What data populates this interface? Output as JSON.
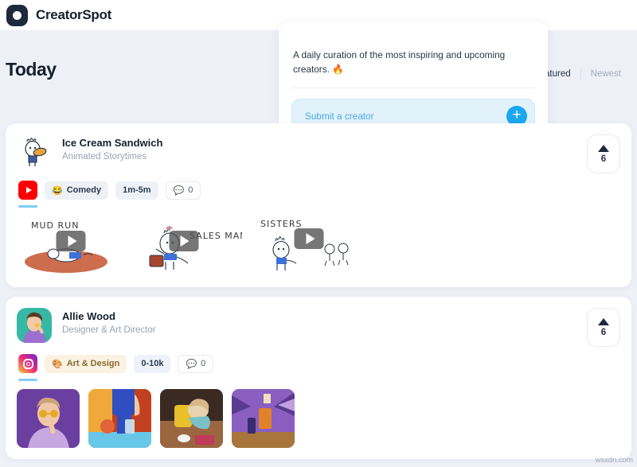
{
  "brand": {
    "name": "CreatorSpot",
    "logo_icon": "circle-logo-icon"
  },
  "hero": {
    "section_title": "Today",
    "tabs": [
      {
        "label": "Featured",
        "active": true
      },
      {
        "label": "Newest",
        "active": false
      }
    ]
  },
  "promo": {
    "description": "A daily curation of the most inspiring and upcoming creators. 🔥",
    "submit_placeholder": "Submit a creator",
    "submit_icon": "plus-icon",
    "accent_color": "#1ca7ef"
  },
  "cards": [
    {
      "name": "Ice Cream Sandwich",
      "role": "Animated Storytimes",
      "platform": "youtube",
      "platform_icon": "youtube-icon",
      "category": {
        "emoji": "😂",
        "label": "Comedy",
        "style": "gray"
      },
      "duration": "1m-5m",
      "comments": "0",
      "comment_icon": "comment-icon",
      "votes": "6",
      "vote_icon": "upvote-triangle-icon",
      "media_type": "video",
      "thumbnails": [
        {
          "title": "MUD RUN"
        },
        {
          "title": "SALES MAN"
        },
        {
          "title": "SISTERS"
        }
      ]
    },
    {
      "name": "Allie Wood",
      "role": "Designer & Art Director",
      "platform": "instagram",
      "platform_icon": "instagram-icon",
      "category": {
        "emoji": "🎨",
        "label": "Art & Design",
        "style": "tan"
      },
      "duration": "0-10k",
      "comments": "0",
      "comment_icon": "comment-icon",
      "votes": "6",
      "vote_icon": "upvote-triangle-icon",
      "media_type": "photo",
      "thumbnails": [
        {
          "title": ""
        },
        {
          "title": ""
        },
        {
          "title": ""
        },
        {
          "title": ""
        }
      ]
    }
  ],
  "watermark": "wsxdn.com"
}
